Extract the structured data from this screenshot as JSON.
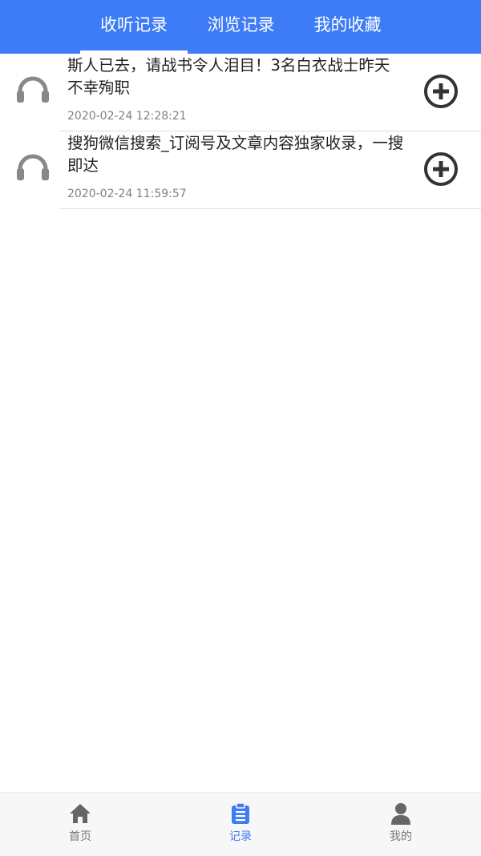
{
  "tabs": [
    {
      "label": "收听记录",
      "active": true
    },
    {
      "label": "浏览记录",
      "active": false
    },
    {
      "label": "我的收藏",
      "active": false
    }
  ],
  "items": [
    {
      "title": "斯人已去，请战书令人泪目！3名白衣战士昨天不幸殉职",
      "time": "2020-02-24 12:28:21",
      "icon": "headphones-icon",
      "action_icon": "plus-circle-icon"
    },
    {
      "title": "搜狗微信搜索_订阅号及文章内容独家收录，一搜即达",
      "time": "2020-02-24 11:59:57",
      "icon": "headphones-icon",
      "action_icon": "plus-circle-icon"
    }
  ],
  "bottom_nav": [
    {
      "label": "首页",
      "icon": "home-icon",
      "active": false
    },
    {
      "label": "记录",
      "icon": "clipboard-icon",
      "active": true
    },
    {
      "label": "我的",
      "icon": "user-icon",
      "active": false
    }
  ],
  "colors": {
    "accent": "#3d7cf6",
    "icon_gray": "#888888",
    "add_icon": "#333333"
  }
}
